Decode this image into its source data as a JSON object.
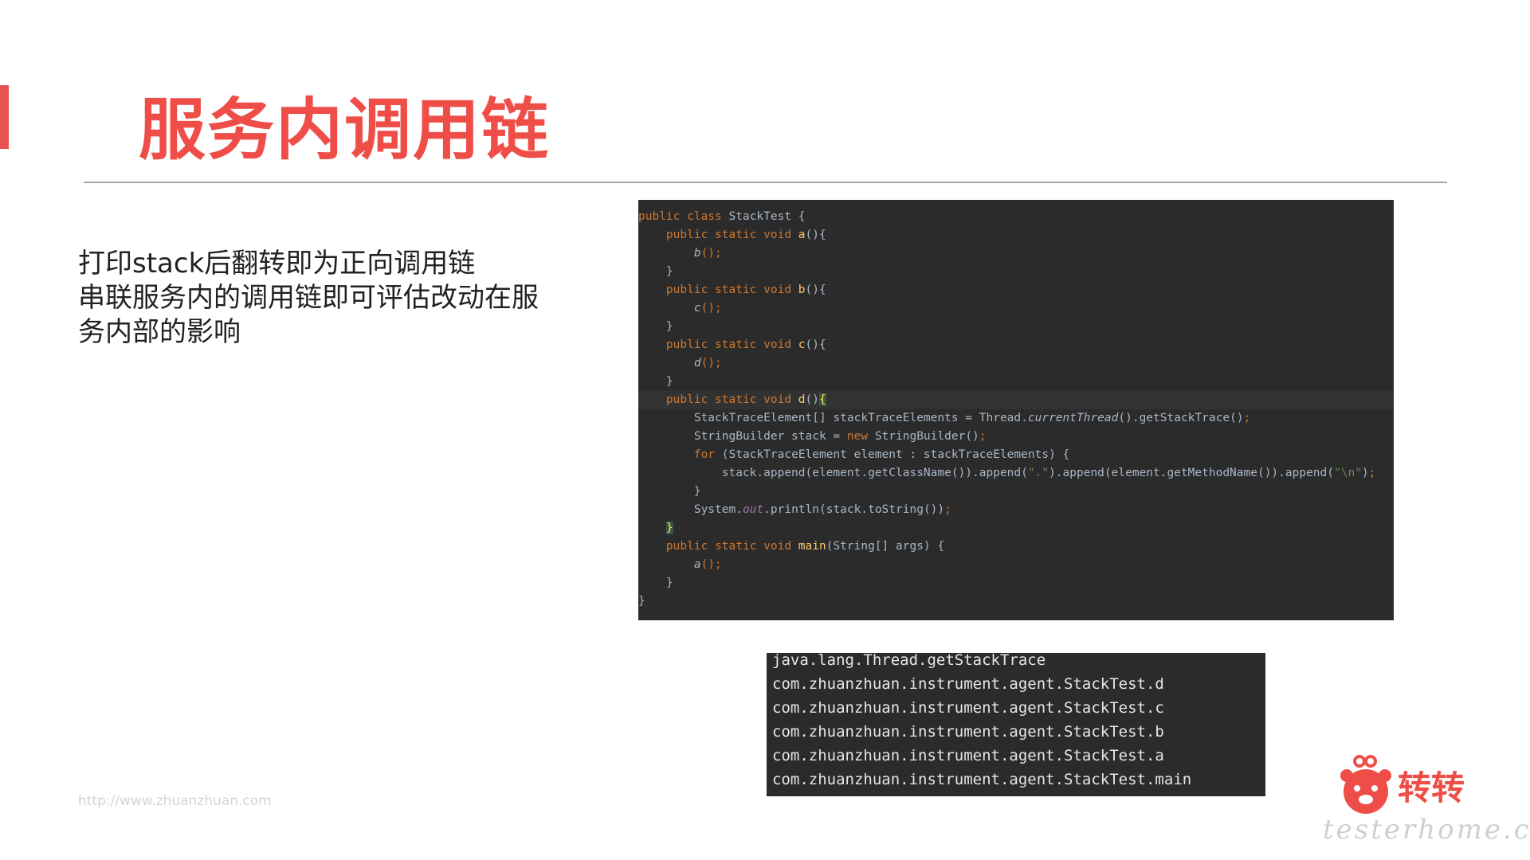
{
  "slide": {
    "title": "服务内调用链",
    "description_lines": [
      "打印stack后翻转即为正向调用链",
      "串联服务内的调用链即可评估改动在服",
      "务内部的影响"
    ],
    "footer_url": "http://www.zhuanzhuan.com",
    "brand_name": "转转",
    "watermark": "testerhome.com",
    "accent_color": "#ef4e48"
  },
  "code": {
    "l1": {
      "a": "public class ",
      "b": "StackTest {"
    },
    "l2": {
      "a": "    public static void ",
      "b": "a",
      "c": "(){"
    },
    "l3": {
      "a": "        ",
      "b": "b",
      "c": "();"
    },
    "l4": "    }",
    "l5": {
      "a": "    public static void ",
      "b": "b",
      "c": "(){"
    },
    "l6": {
      "a": "        ",
      "b": "c",
      "c": "();"
    },
    "l7": "    }",
    "l8": {
      "a": "    public static void ",
      "b": "c",
      "c": "(){"
    },
    "l9": {
      "a": "        ",
      "b": "d",
      "c": "();"
    },
    "l10": "    }",
    "l11": {
      "a": "    public static void ",
      "b": "d",
      "c": "()",
      "d": "{"
    },
    "l12": {
      "a": "        StackTraceElement[] stackTraceElements = Thread.",
      "b": "currentThread",
      "c": "().getStackTrace()",
      "d": ";"
    },
    "l13": {
      "a": "        StringBuilder stack = ",
      "b": "new ",
      "c": "StringBuilder()",
      "d": ";"
    },
    "l14": {
      "a": "        ",
      "b": "for ",
      "c": "(StackTraceElement element : stackTraceElements) {"
    },
    "l15": {
      "a": "            stack.append(element.getClassName()).append(",
      "b": "\".\"",
      "c": ").append(element.getMethodName()).append(",
      "d": "\"\\n\"",
      "e": ")",
      "f": ";"
    },
    "l16": "        }",
    "l17": {
      "a": "        System.",
      "b": "out",
      "c": ".println(stack.toString())",
      "d": ";"
    },
    "l18": {
      "a": "    ",
      "b": "}"
    },
    "l19": {
      "a": "    public static void ",
      "b": "main",
      "c": "(String[] args) {"
    },
    "l20": {
      "a": "        ",
      "b": "a",
      "c": "();"
    },
    "l21": "    }",
    "l22": "}"
  },
  "output": {
    "lines": [
      "java.lang.Thread.getStackTrace",
      "com.zhuanzhuan.instrument.agent.StackTest.d",
      "com.zhuanzhuan.instrument.agent.StackTest.c",
      "com.zhuanzhuan.instrument.agent.StackTest.b",
      "com.zhuanzhuan.instrument.agent.StackTest.a",
      "com.zhuanzhuan.instrument.agent.StackTest.main"
    ]
  }
}
